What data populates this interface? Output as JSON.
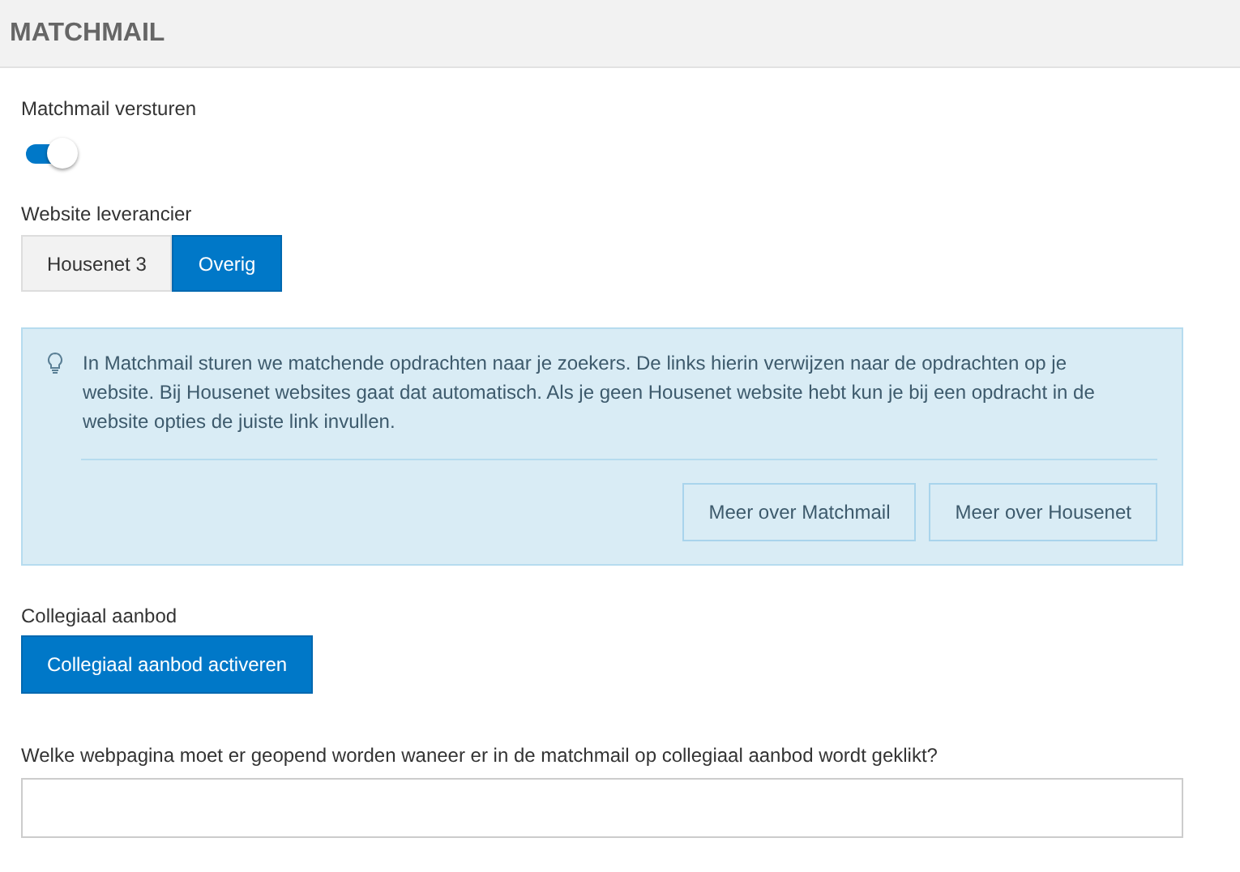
{
  "header": {
    "title": "MATCHMAIL"
  },
  "send_toggle": {
    "label": "Matchmail versturen",
    "on": true
  },
  "supplier": {
    "label": "Website leverancier",
    "options": [
      {
        "label": "Housenet 3",
        "selected": false
      },
      {
        "label": "Overig",
        "selected": true
      }
    ]
  },
  "info": {
    "text": "In Matchmail sturen we matchende opdrachten naar je zoekers. De links hierin verwijzen naar de opdrachten op je website. Bij Housenet websites gaat dat automatisch. Als je geen Housenet website hebt kun je bij een opdracht in de website opties de juiste link invullen.",
    "buttons": [
      "Meer over Matchmail",
      "Meer over Housenet"
    ]
  },
  "collegial": {
    "label": "Collegiaal aanbod",
    "button": "Collegiaal aanbod activeren"
  },
  "webpage": {
    "label": "Welke webpagina moet er geopend worden waneer er in de matchmail op collegiaal aanbod wordt geklikt?"
  }
}
